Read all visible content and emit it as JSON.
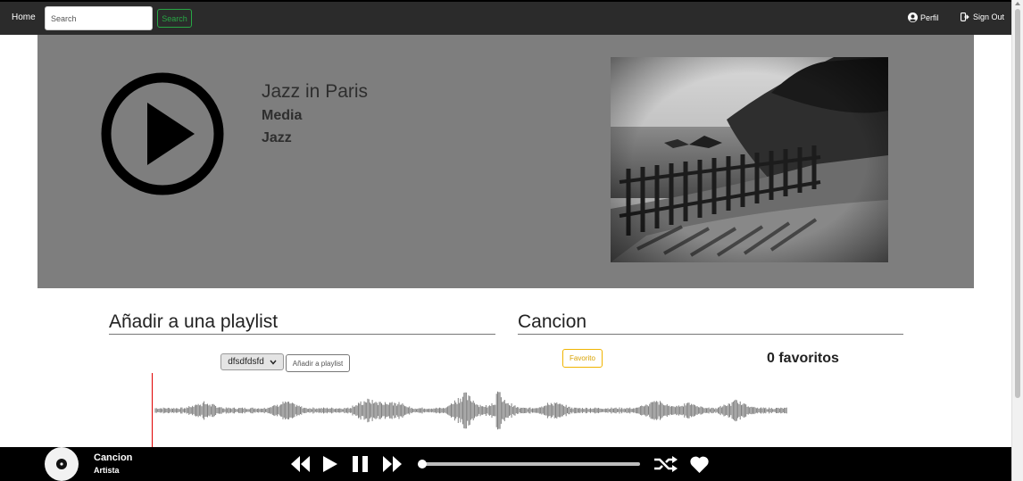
{
  "nav": {
    "home": "Home",
    "search_placeholder": "Search",
    "search_button": "Search",
    "profile": "Perfil",
    "sign_out": "Sign Out"
  },
  "album": {
    "title": "Jazz in Paris",
    "subtitle": "Media",
    "genre": "Jazz",
    "photo_icon": "coastal-fence-photo"
  },
  "playlist_section": {
    "title": "Añadir a una playlist",
    "selected_playlist": "dfsdfdsfd",
    "add_button": "Añadir a playlist"
  },
  "song_section": {
    "title": "Cancion",
    "favorite_button": "Favorito",
    "favorites_count": "0 favoritos"
  },
  "player": {
    "title": "Cancion",
    "artist": "Artista",
    "progress": 0
  },
  "colors": {
    "navbar": "#2b2b2b",
    "hero": "#7e7e7e",
    "search_accent": "#28a745",
    "favorite_accent": "#f0b400",
    "playhead": "#e00000"
  }
}
